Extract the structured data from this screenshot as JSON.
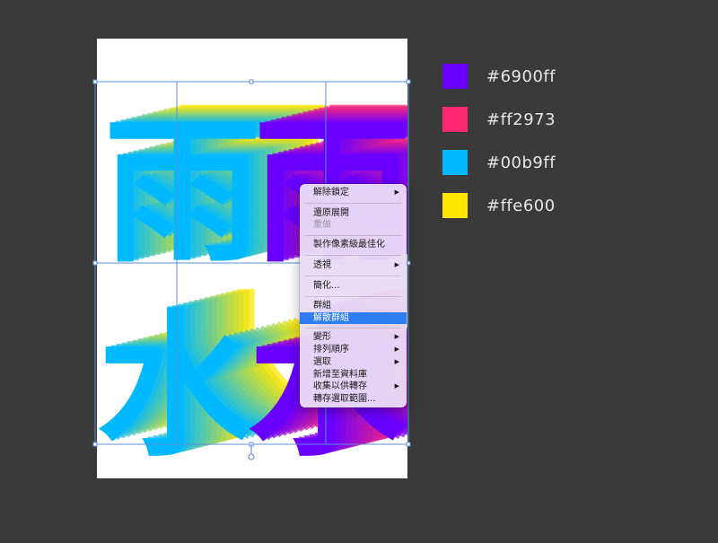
{
  "swatches": [
    {
      "color": "#6900ff",
      "label": "#6900ff"
    },
    {
      "color": "#ff2973",
      "label": "#ff2973"
    },
    {
      "color": "#00b9ff",
      "label": "#00b9ff"
    },
    {
      "color": "#ffe600",
      "label": "#ffe600"
    }
  ],
  "colors": {
    "artboard_bg": "#ffffff",
    "workspace_bg": "#3a3a3a",
    "selection": "#5c8fd6",
    "menu_highlight": "#2f7df2",
    "glyph_blue": "#00b9ff",
    "glyph_purple": "#6900ff"
  },
  "artwork": {
    "glyphs": [
      "雨",
      "雨",
      "水",
      "水"
    ]
  },
  "context_menu": {
    "items": {
      "unlock": "解除鎖定",
      "undo": "還原展開",
      "redo": "重做",
      "pixel_perfect": "製作像素級最佳化",
      "perspective": "透視",
      "simplify": "簡化...",
      "group": "群組",
      "ungroup": "解散群組",
      "transform": "變形",
      "arrange": "排列順序",
      "select": "選取",
      "add_to_library": "新增至資料庫",
      "collect_for_export": "收集以供轉存",
      "export_selection": "轉存選取範圍..."
    },
    "submenu_arrow": "▶"
  }
}
